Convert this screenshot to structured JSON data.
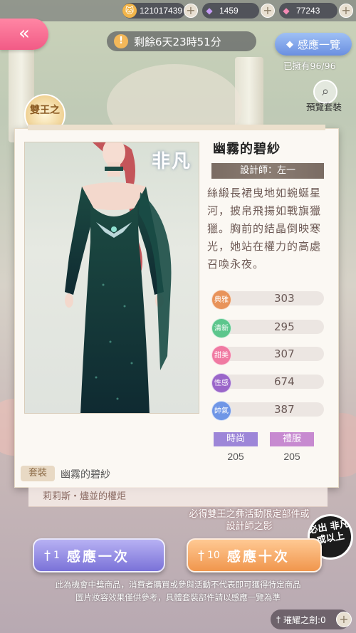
{
  "resources": [
    {
      "icon": "cat-coin-icon",
      "value": "121017439"
    },
    {
      "icon": "purple-diamond-icon",
      "value": "1459"
    },
    {
      "icon": "pink-diamond-icon",
      "value": "77243"
    }
  ],
  "countdown": "剩餘6天23時51分",
  "overview_label": "感應一覽",
  "owned_label": "已擁有96/96",
  "preview_label": "預覽套裝",
  "event_badge": "雙王之",
  "card": {
    "rarity": "非凡",
    "item_name": "幽霧的碧紗",
    "designer": "設計師：左一",
    "description": "絲緞長裙曳地如蜿蜒星河，披帛飛揚如戰旗獵獵。胸前的結晶倒映寒光，她站在權力的高處召喚永夜。",
    "stats": [
      {
        "label": "典雅",
        "value": "303",
        "color": "#e8935a"
      },
      {
        "label": "清新",
        "value": "295",
        "color": "#5cc68c"
      },
      {
        "label": "甜美",
        "value": "307",
        "color": "#f07aa2"
      },
      {
        "label": "性感",
        "value": "674",
        "color": "#9a66c9"
      },
      {
        "label": "帥氣",
        "value": "387",
        "color": "#6f96e6"
      }
    ],
    "tags": [
      {
        "label": "時尚",
        "value": "205",
        "color": "#9d86d8"
      },
      {
        "label": "禮服",
        "value": "205",
        "color": "#c78ad0"
      }
    ],
    "set_label": "套裝",
    "set_name": "幽霧的碧紗"
  },
  "under_strip": "莉莉斯・燼並的權炬",
  "hint": "必得雙王之彝活動限定部件或設計師之影",
  "stamp": "必出 非凡 或以上",
  "summon_one": {
    "cost": "1",
    "label": "感應一次"
  },
  "summon_ten": {
    "cost": "10",
    "label": "感應十次"
  },
  "disclaimer_1": "此為機會中獎商品，消費者購買或參與活動不代表即可獲得特定商品",
  "disclaimer_2": "圖片妝容效果僅供參考，具體套裝部件請以感應一覽為準",
  "bottom_resource": "璀耀之劍:0"
}
